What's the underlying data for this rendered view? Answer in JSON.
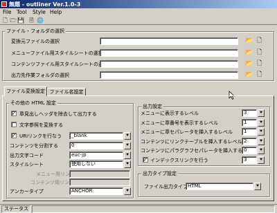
{
  "window": {
    "title": "無題 - outliner Ver.1.0-3"
  },
  "menu": [
    "File",
    "Tool",
    "Style",
    "Help"
  ],
  "toolbar_icons": [
    "new-file-icon",
    "open-file-icon",
    "save-file-icon",
    "export-icon",
    "web-icon"
  ],
  "file_folder_group": {
    "title": "ファイル・フォルダの選択",
    "rows": [
      {
        "label": "変換元ファイルの選択",
        "value": ""
      },
      {
        "label": "メニューファイル用スタイルシートの選択",
        "value": ""
      },
      {
        "label": "コンテンツファイル用スタイルシートの選択",
        "value": ""
      },
      {
        "label": "出力先作業フォルダの選択",
        "value": ""
      }
    ]
  },
  "tabs": [
    "ファイル変換設定",
    "ファイル名設定"
  ],
  "html_settings": {
    "title": "その他の HTML 設定",
    "check_strip_header": "章見出しヘッダを除去して出力する",
    "check_char_ref": "文字参照を変換する",
    "check_uri_link": "URIリンクを行なう",
    "uri_link_value": "_blank",
    "split_label": "コンテンツを分割する",
    "split_value": "0",
    "encoding_label": "出力文字コード",
    "encoding_value": "euc-jp",
    "stylesheet_label": "スタイルシート",
    "stylesheet_value": "使用しない",
    "menu_link_label": "メニュー用リンク",
    "content_link_label": "コンテンツ用リンク",
    "anchor_label": "アンカータイプ",
    "anchor_value": "ANCHOR"
  },
  "output_settings": {
    "title": "出力設定",
    "rows": [
      {
        "label": "メニューに表示するレベル",
        "value": "3"
      },
      {
        "label": "メニューに章番号を表示するレベル",
        "value": "1"
      },
      {
        "label": "メニューに章セパレータを挿入するレベル",
        "value": "1"
      },
      {
        "label": "コンテンツにリンクテーブルを挿入するレベル",
        "value": "2"
      },
      {
        "label": "コンテンツにパラグラフセパレータを挿入するレベル",
        "value": "0"
      }
    ],
    "index_link_label": "インデックスリンクを行う",
    "index_link_value": "3"
  },
  "output_type": {
    "title": "出力タイプ設定",
    "label": "ファイル出力タイプ",
    "value": "HTML"
  },
  "status": {
    "label": "ステータス"
  },
  "colors": {
    "titlebar_start": "#0a246a",
    "titlebar_end": "#a6caf0",
    "face": "#d4d0c8"
  }
}
